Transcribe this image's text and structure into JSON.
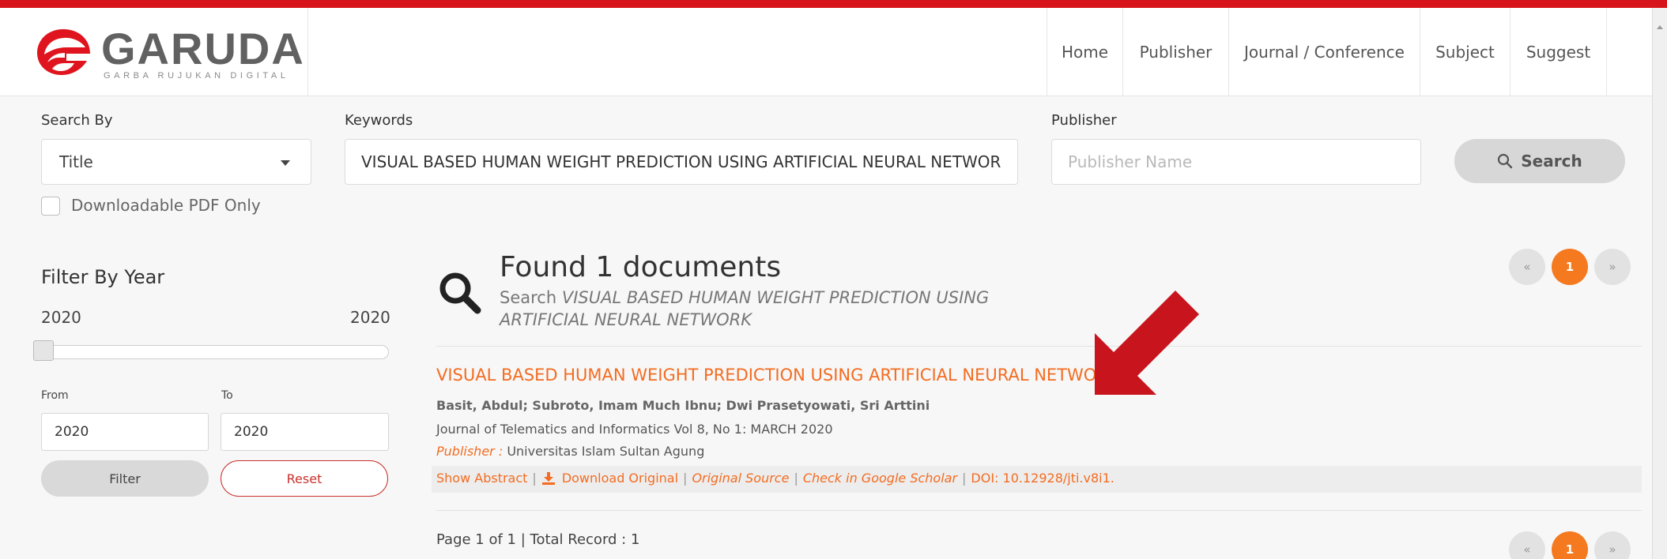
{
  "brand": {
    "name": "GARUDA",
    "tagline": "GARBA RUJUKAN DIGITAL",
    "accent_color": "#d7141c",
    "link_color": "#f36c21"
  },
  "nav": {
    "items": [
      "Home",
      "Publisher",
      "Journal / Conference",
      "Subject",
      "Suggest"
    ]
  },
  "search": {
    "search_by_label": "Search By",
    "search_by_value": "Title",
    "keywords_label": "Keywords",
    "keywords_value": "VISUAL BASED HUMAN WEIGHT PREDICTION USING ARTIFICIAL NEURAL NETWORK",
    "publisher_label": "Publisher",
    "publisher_placeholder": "Publisher Name",
    "button_label": "Search",
    "pdf_only_label": "Downloadable PDF Only",
    "pdf_only_checked": false
  },
  "filter": {
    "title": "Filter By Year",
    "range_min": "2020",
    "range_max": "2020",
    "from_label": "From",
    "to_label": "To",
    "from_value": "2020",
    "to_value": "2020",
    "filter_button": "Filter",
    "reset_button": "Reset"
  },
  "results": {
    "found_text": "Found 1 documents",
    "search_prefix": "Search",
    "search_query": "VISUAL BASED HUMAN WEIGHT PREDICTION USING ARTIFICIAL NEURAL NETWORK",
    "documents": [
      {
        "title": "VISUAL BASED HUMAN WEIGHT PREDICTION USING ARTIFICIAL NEURAL NETWORK",
        "authors": "Basit, Abdul; Subroto, Imam Much Ibnu; Dwi Prasetyowati, Sri Arttini",
        "journal": "Journal of Telematics and Informatics Vol 8, No 1: MARCH 2020",
        "publisher_label": "Publisher :",
        "publisher": "Universitas Islam Sultan Agung",
        "show_abstract": "Show Abstract",
        "download_original": "Download Original",
        "original_source": "Original Source",
        "google_scholar": "Check in Google Scholar",
        "doi": "DOI: 10.12928/jti.v8i1."
      }
    ],
    "page_info": "Page 1 of 1 | Total Record : 1"
  },
  "pagination": {
    "prev": "«",
    "current": "1",
    "next": "»"
  },
  "icons": {
    "search": "magnifier-icon",
    "download": "download-icon",
    "annotation": "red-arrow-icon",
    "annotation_color": "#c8141c"
  }
}
